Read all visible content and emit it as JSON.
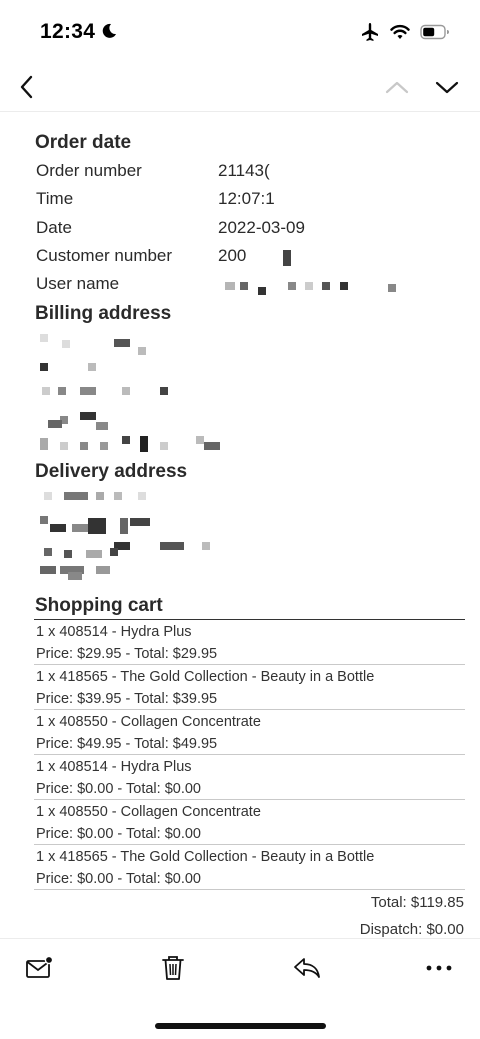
{
  "status_bar": {
    "time": "12:34",
    "icons": [
      "moon-icon",
      "airplane-icon",
      "wifi-icon",
      "battery-icon"
    ]
  },
  "nav": {
    "icons": [
      "chevron-left-icon",
      "chevron-up-icon",
      "chevron-down-icon"
    ]
  },
  "order": {
    "heading": "Order date",
    "rows": [
      {
        "label": "Order number",
        "value": "21143("
      },
      {
        "label": "Time",
        "value": "12:07:1\t"
      },
      {
        "label": "Date",
        "value": "2022-03-09"
      },
      {
        "label": "Customer number",
        "value": "200"
      },
      {
        "label": "User name",
        "value": ""
      }
    ]
  },
  "billing": {
    "heading": "Billing address"
  },
  "delivery": {
    "heading": "Delivery address"
  },
  "cart": {
    "heading": "Shopping cart",
    "items": [
      {
        "line1": "1 x 408514 - Hydra Plus",
        "line2": "Price: $29.95 - Total: $29.95"
      },
      {
        "line1": "1 x 418565 - The Gold Collection - Beauty in a Bottle",
        "line2": "Price: $39.95 - Total: $39.95"
      },
      {
        "line1": "1 x 408550 - Collagen Concentrate",
        "line2": "Price: $49.95 - Total: $49.95"
      },
      {
        "line1": "1 x 408514 - Hydra Plus",
        "line2": "Price: $0.00 - Total: $0.00"
      },
      {
        "line1": "1 x 408550 - Collagen Concentrate",
        "line2": "Price: $0.00 - Total: $0.00"
      },
      {
        "line1": "1 x 418565 - The Gold Collection - Beauty in a Bottle",
        "line2": "Price: $0.00 - Total: $0.00"
      }
    ],
    "total": "Total: $119.85",
    "dispatch": "Dispatch: $0.00"
  },
  "toolbar": {
    "icons": [
      "mail-unread-icon",
      "trash-icon",
      "reply-icon",
      "more-icon"
    ]
  }
}
